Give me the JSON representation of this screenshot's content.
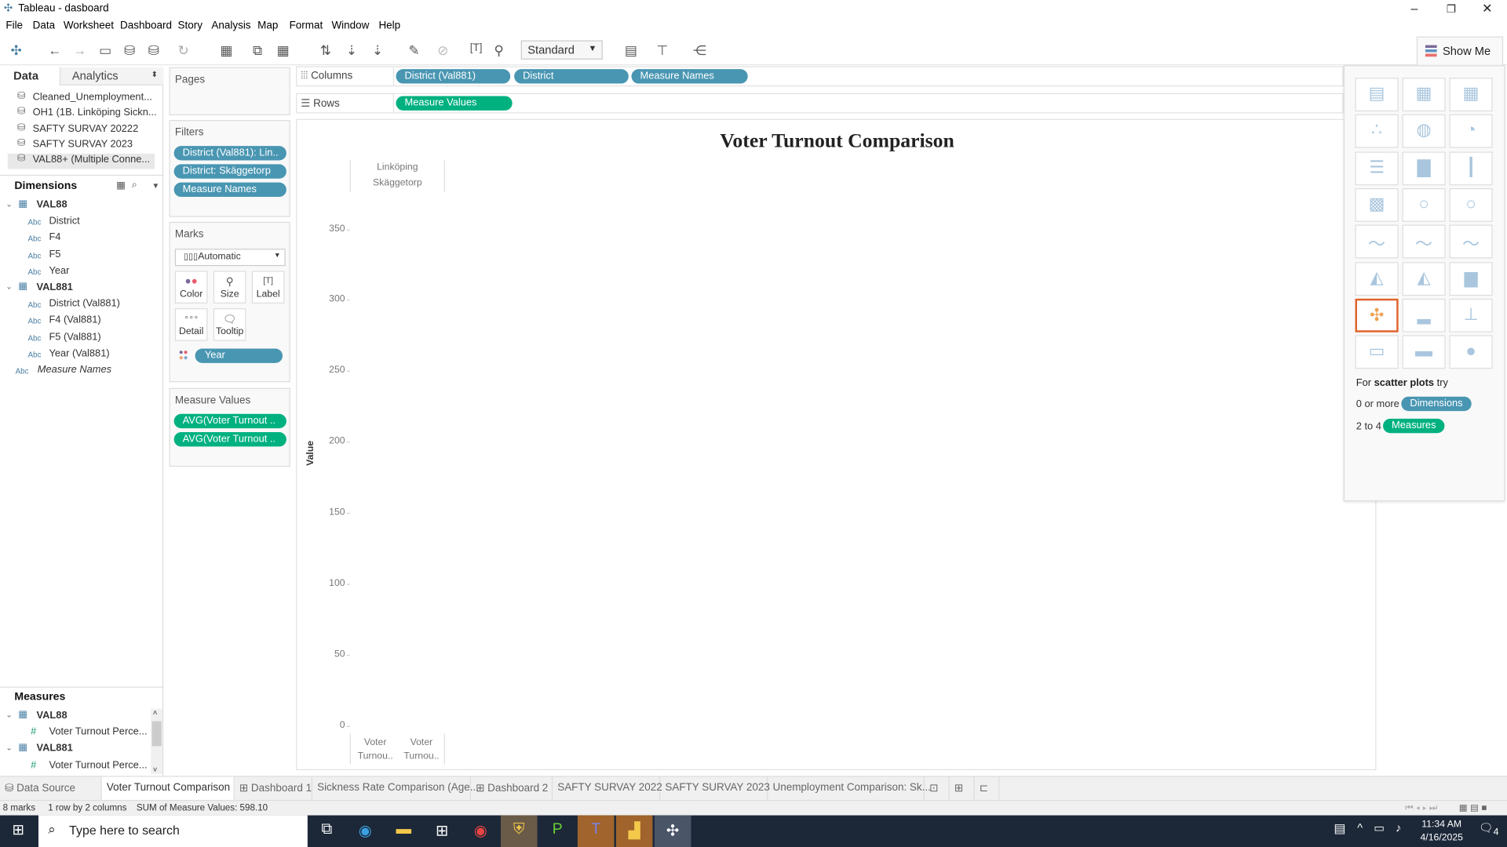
{
  "window": {
    "title": "Tableau - dasboard",
    "controls": [
      "minimize",
      "restore",
      "close"
    ]
  },
  "menu": [
    "File",
    "Data",
    "Worksheet",
    "Dashboard",
    "Story",
    "Analysis",
    "Map",
    "Format",
    "Window",
    "Help"
  ],
  "toolbar": {
    "fit_select": "Standard",
    "show_me": "Show Me"
  },
  "left_pane": {
    "tabs": [
      "Data",
      "Analytics"
    ],
    "data_sources": [
      "Cleaned_Unemployment...",
      "OH1 (1B. Linköping Sickn...",
      "SAFTY SURVAY 20222",
      "SAFTY SURVAY 2023",
      "VAL88+ (Multiple Conne..."
    ],
    "dimensions_header": "Dimensions",
    "dimension_groups": [
      {
        "name": "VAL88",
        "fields": [
          "District",
          "F4",
          "F5",
          "Year"
        ]
      },
      {
        "name": "VAL881",
        "fields": [
          "District (Val881)",
          "F4 (Val881)",
          "F5 (Val881)",
          "Year (Val881)"
        ]
      }
    ],
    "measure_names_field": "Measure Names",
    "field_type": "Abc",
    "measures_header": "Measures",
    "measure_groups": [
      {
        "name": "VAL88",
        "fields": [
          "Voter Turnout Perce..."
        ]
      },
      {
        "name": "VAL881",
        "fields": [
          "Voter Turnout Perce..."
        ]
      }
    ]
  },
  "cards": {
    "pages": "Pages",
    "filters": {
      "title": "Filters",
      "pills": [
        "District (Val881): Lin..",
        "District: Skäggetorp",
        "Measure Names"
      ]
    },
    "marks": {
      "title": "Marks",
      "type": "Automatic",
      "buttons": [
        "Color",
        "Size",
        "Label",
        "Detail",
        "Tooltip"
      ],
      "color_pill": "Year"
    },
    "measure_values": {
      "title": "Measure Values",
      "pills": [
        "AVG(Voter Turnout ..",
        "AVG(Voter Turnout .."
      ]
    }
  },
  "shelves": {
    "columns": {
      "label": "Columns",
      "pills": [
        "District (Val881)",
        "District",
        "Measure Names"
      ]
    },
    "rows": {
      "label": "Rows",
      "pills": [
        "Measure Values"
      ]
    }
  },
  "chart_data": {
    "type": "bar",
    "title": "Voter Turnout Comparison",
    "column_headers": [
      "Linköping",
      "Skäggetorp"
    ],
    "categories": [
      "Voter Turnou..",
      "Voter Turnou.."
    ],
    "ylabel": "Value",
    "yticks": [
      0,
      50,
      100,
      150,
      200,
      250,
      300,
      350
    ],
    "ylim": [
      0,
      370
    ],
    "grid": false,
    "series": []
  },
  "show_me": {
    "hint_prefix": "For",
    "hint_bold": "scatter plots",
    "hint_suffix": "try",
    "dims_prefix": "0 or more",
    "dims_pill": "Dimensions",
    "meas_prefix": "2 to 4",
    "meas_pill": "Measures",
    "selected": "scatter-plot"
  },
  "sheet_tabs": [
    "Data Source",
    "Voter Turnout Comparison",
    "Dashboard 1",
    "Sickness Rate Comparison (Age...",
    "Dashboard 2",
    "SAFTY SURVAY 2022",
    "SAFTY SURVAY 2023",
    "Unemployment Comparison: Sk..."
  ],
  "status": {
    "marks": "8 marks",
    "dims": "1 row by 2 columns",
    "sum": "SUM of Measure Values: 598.10"
  },
  "taskbar": {
    "search_placeholder": "Type here to search",
    "time": "11:34 AM",
    "date": "4/16/2025",
    "notifications": "4"
  },
  "colors": {
    "dimension_pill": "#4996b2",
    "measure_pill": "#00b180",
    "taskbar": "#1c2838",
    "selected_chart": "#e0622b"
  }
}
